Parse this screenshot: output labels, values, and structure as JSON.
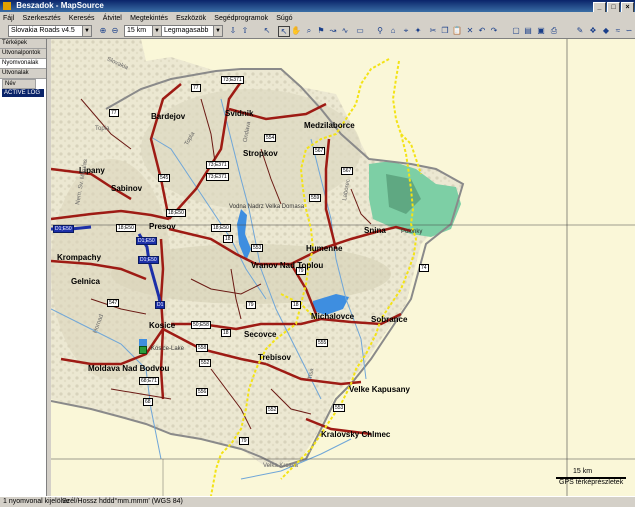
{
  "window": {
    "title": "Beszadok - MapSource"
  },
  "menu": [
    "Fájl",
    "Szerkesztés",
    "Keresés",
    "Átvitel",
    "Megtekintés",
    "Eszközök",
    "Segédprogramok",
    "Súgó"
  ],
  "toolbar": {
    "product_select": "Slovakia Roads v4.5",
    "zoom_select": "15 km",
    "detail_select": "Legmagasabb"
  },
  "left_panel": {
    "tabs": [
      "Térképek",
      "Útvonalpontok",
      "Nyomvonalak",
      "Útvonalak"
    ],
    "column_header": "Név",
    "items": [
      "ACTIVE LOG"
    ]
  },
  "map": {
    "cities": [
      "Medzilaborce",
      "Bardejov",
      "Svidnik",
      "Stropkov",
      "Lipany",
      "Sabinov",
      "Presov",
      "Humenne",
      "Snina",
      "Vranov Nad Toplou",
      "Krompachy",
      "Gelnica",
      "Kosice",
      "Michalovce",
      "Sobrance",
      "Secovce",
      "Trebisov",
      "Moldava Nad Bodvou",
      "Velke Kapusany",
      "Kralovsky Chlmec"
    ],
    "labels": [
      "Slovakia",
      "Topla",
      "Topla",
      "Ondava",
      "Nem. Sv. Mikulas",
      "Vodna Nadrz Velka Domasa",
      "Polonky",
      "Laborec",
      "Tisa",
      "Velka Krcava",
      "Hornad",
      "Kosice-Lake"
    ],
    "road_shields": [
      "77",
      "77",
      "73;E371",
      "545",
      "73;E371",
      "73;E371",
      "18;E50",
      "18;E50",
      "18;E50",
      "D1;E50",
      "D1;E50",
      "D1;E50",
      "D1",
      "18",
      "547",
      "559",
      "553",
      "18",
      "554",
      "567",
      "50;E58",
      "552",
      "68;E71",
      "68",
      "79",
      "74",
      "79",
      "555",
      "552",
      "79",
      "553",
      "18",
      "567",
      "558",
      "556"
    ],
    "scale_label": "15 km",
    "status_overlay": "GPS térképrészletek"
  },
  "statusbar": {
    "left": "1 nyomvonal kijelölve",
    "coords": "Szél/Hossz hddd°mm.mmm' (WGS 84)"
  },
  "colors": {
    "map_bg": "#faf7d8",
    "title_bar": "#0a246a",
    "road_red": "#9e1b14",
    "highway_blue": "#1c2fa8",
    "track_yellow": "#f3e316",
    "forest_green": "#78c8a0"
  }
}
